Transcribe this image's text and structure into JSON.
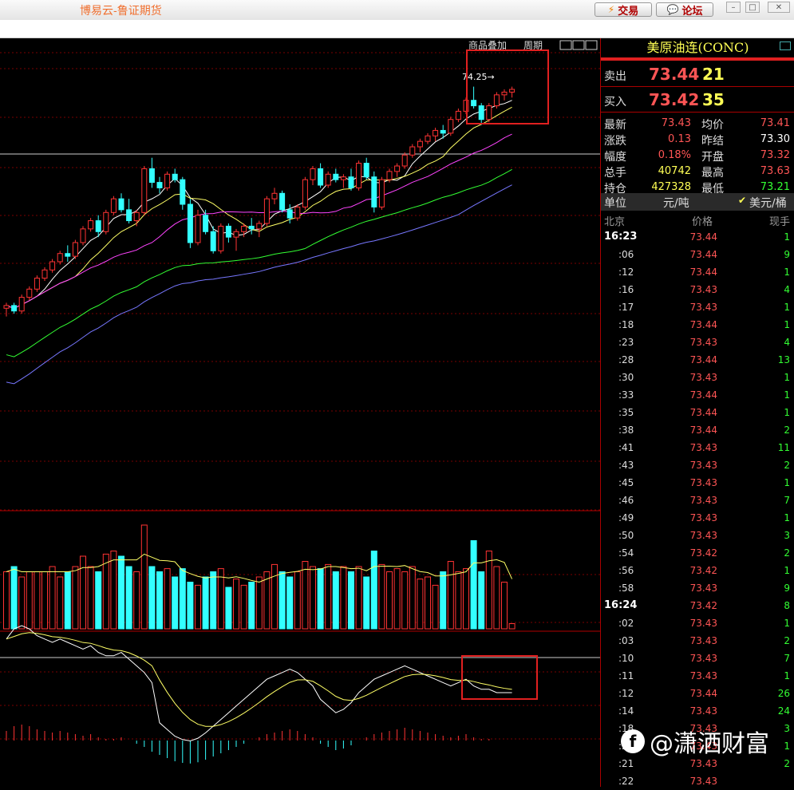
{
  "window": {
    "title": "博易云-鲁证期货",
    "trade_button": "交易",
    "forum_button": "论坛",
    "trade_icon": "lightning-icon",
    "forum_icon": "speech-bubble-icon"
  },
  "chart_toolbar": {
    "overlay_label": "商品叠加",
    "period_label": "周期"
  },
  "chart_annotation": {
    "high_label": "74.25→"
  },
  "colors": {
    "up": "#ff3333",
    "down": "#33ffff",
    "ma5": "#ffffff",
    "ma10": "#ffff66",
    "ma20": "#ff44ff",
    "ma40": "#33ff33",
    "ma60": "#7777ff",
    "highlight": "#e02020"
  },
  "panel": {
    "title": "美原油连(CONC)",
    "sell": {
      "label": "卖出",
      "price": "73.44",
      "vol": "21"
    },
    "buy": {
      "label": "买入",
      "price": "73.42",
      "vol": "35"
    },
    "stats": [
      {
        "l1": "最新",
        "v1": "73.43",
        "c1": "#ff5555",
        "l2": "均价",
        "v2": "73.41",
        "c2": "#ff5555"
      },
      {
        "l1": "涨跌",
        "v1": "0.13",
        "c1": "#ff5555",
        "l2": "昨结",
        "v2": "73.30",
        "c2": "#ffffff"
      },
      {
        "l1": "幅度",
        "v1": "0.18%",
        "c1": "#ff5555",
        "l2": "开盘",
        "v2": "73.32",
        "c2": "#ff5555"
      },
      {
        "l1": "总手",
        "v1": "40742",
        "c1": "#ffff55",
        "l2": "最高",
        "v2": "73.63",
        "c2": "#ff5555"
      },
      {
        "l1": "持仓",
        "v1": "427328",
        "c1": "#ffff55",
        "l2": "最低",
        "v2": "73.21",
        "c2": "#33ff33"
      }
    ],
    "unit_label": "单位",
    "unit_cny": "元/吨",
    "unit_usd": "美元/桶",
    "tick_head": {
      "time": "北京",
      "price": "价格",
      "vol": "现手"
    },
    "ticks": [
      {
        "t": "16:23",
        "p": "73.44",
        "v": "1"
      },
      {
        "t": ":06",
        "p": "73.44",
        "v": "9"
      },
      {
        "t": ":12",
        "p": "73.44",
        "v": "1"
      },
      {
        "t": ":16",
        "p": "73.43",
        "v": "4"
      },
      {
        "t": ":17",
        "p": "73.43",
        "v": "1"
      },
      {
        "t": ":18",
        "p": "73.44",
        "v": "1"
      },
      {
        "t": ":23",
        "p": "73.43",
        "v": "4"
      },
      {
        "t": ":28",
        "p": "73.44",
        "v": "13"
      },
      {
        "t": ":30",
        "p": "73.43",
        "v": "1"
      },
      {
        "t": ":33",
        "p": "73.44",
        "v": "1"
      },
      {
        "t": ":35",
        "p": "73.44",
        "v": "1"
      },
      {
        "t": ":38",
        "p": "73.44",
        "v": "2"
      },
      {
        "t": ":41",
        "p": "73.43",
        "v": "11"
      },
      {
        "t": ":43",
        "p": "73.43",
        "v": "2"
      },
      {
        "t": ":45",
        "p": "73.43",
        "v": "1"
      },
      {
        "t": ":46",
        "p": "73.43",
        "v": "7"
      },
      {
        "t": ":49",
        "p": "73.43",
        "v": "1"
      },
      {
        "t": ":50",
        "p": "73.43",
        "v": "3"
      },
      {
        "t": ":54",
        "p": "73.42",
        "v": "2"
      },
      {
        "t": ":56",
        "p": "73.42",
        "v": "1"
      },
      {
        "t": ":58",
        "p": "73.43",
        "v": "9"
      },
      {
        "t": "16:24",
        "p": "73.42",
        "v": "8"
      },
      {
        "t": ":02",
        "p": "73.43",
        "v": "1"
      },
      {
        "t": ":03",
        "p": "73.43",
        "v": "2"
      },
      {
        "t": ":10",
        "p": "73.43",
        "v": "7"
      },
      {
        "t": ":11",
        "p": "73.43",
        "v": "1"
      },
      {
        "t": ":12",
        "p": "73.44",
        "v": "26"
      },
      {
        "t": ":14",
        "p": "73.43",
        "v": "24"
      },
      {
        "t": ":18",
        "p": "73.43",
        "v": "3"
      },
      {
        "t": ":20",
        "p": "73.43",
        "v": "1"
      },
      {
        "t": ":21",
        "p": "73.43",
        "v": "2"
      },
      {
        "t": ":22",
        "p": "73.43",
        "v": ""
      }
    ]
  },
  "watermark": {
    "text": "@潇洒财富"
  },
  "chart_data": {
    "type": "candlestick",
    "candles": [
      [
        70.2,
        70.3,
        70.05,
        70.25
      ],
      [
        70.25,
        70.3,
        70.1,
        70.15
      ],
      [
        70.15,
        70.45,
        70.1,
        70.4
      ],
      [
        70.4,
        70.6,
        70.35,
        70.55
      ],
      [
        70.55,
        70.8,
        70.5,
        70.75
      ],
      [
        70.75,
        70.95,
        70.7,
        70.9
      ],
      [
        70.9,
        71.1,
        70.85,
        71.05
      ],
      [
        71.05,
        71.25,
        71.0,
        71.2
      ],
      [
        71.2,
        71.35,
        71.05,
        71.15
      ],
      [
        71.15,
        71.45,
        71.1,
        71.4
      ],
      [
        71.4,
        71.7,
        71.35,
        71.65
      ],
      [
        71.65,
        71.85,
        71.6,
        71.8
      ],
      [
        71.8,
        71.9,
        71.5,
        71.6
      ],
      [
        71.6,
        72.0,
        71.55,
        71.95
      ],
      [
        71.95,
        72.25,
        71.9,
        72.2
      ],
      [
        72.2,
        72.3,
        71.95,
        72.0
      ],
      [
        72.0,
        72.2,
        71.75,
        71.8
      ],
      [
        71.8,
        72.0,
        71.7,
        71.95
      ],
      [
        71.95,
        72.8,
        71.9,
        72.75
      ],
      [
        72.75,
        72.95,
        72.4,
        72.5
      ],
      [
        72.5,
        72.6,
        72.3,
        72.4
      ],
      [
        72.4,
        72.7,
        72.35,
        72.65
      ],
      [
        72.65,
        72.75,
        72.5,
        72.55
      ],
      [
        72.55,
        72.6,
        72.0,
        72.1
      ],
      [
        72.1,
        72.2,
        71.3,
        71.4
      ],
      [
        71.4,
        72.0,
        71.35,
        71.9
      ],
      [
        71.9,
        72.0,
        71.55,
        71.6
      ],
      [
        71.6,
        71.7,
        71.2,
        71.25
      ],
      [
        71.25,
        71.75,
        71.2,
        71.7
      ],
      [
        71.7,
        71.75,
        71.4,
        71.5
      ],
      [
        71.5,
        71.65,
        71.25,
        71.6
      ],
      [
        71.6,
        71.75,
        71.5,
        71.7
      ],
      [
        71.7,
        71.85,
        71.55,
        71.65
      ],
      [
        71.65,
        71.8,
        71.5,
        71.75
      ],
      [
        71.75,
        72.25,
        71.7,
        72.2
      ],
      [
        72.2,
        72.4,
        72.1,
        72.3
      ],
      [
        72.3,
        72.35,
        71.95,
        72.0
      ],
      [
        72.0,
        72.1,
        71.75,
        71.85
      ],
      [
        71.85,
        72.1,
        71.8,
        72.05
      ],
      [
        72.05,
        72.6,
        72.0,
        72.55
      ],
      [
        72.55,
        72.8,
        72.45,
        72.75
      ],
      [
        72.75,
        72.85,
        72.4,
        72.45
      ],
      [
        72.45,
        72.7,
        72.4,
        72.65
      ],
      [
        72.65,
        72.75,
        72.5,
        72.55
      ],
      [
        72.55,
        72.65,
        72.4,
        72.6
      ],
      [
        72.6,
        72.75,
        72.35,
        72.4
      ],
      [
        72.4,
        72.9,
        72.35,
        72.85
      ],
      [
        72.85,
        72.95,
        72.55,
        72.6
      ],
      [
        72.6,
        72.7,
        71.95,
        72.05
      ],
      [
        72.05,
        72.6,
        72.0,
        72.55
      ],
      [
        72.55,
        72.75,
        72.5,
        72.7
      ],
      [
        72.7,
        72.85,
        72.6,
        72.8
      ],
      [
        72.8,
        73.05,
        72.75,
        73.0
      ],
      [
        73.0,
        73.2,
        72.95,
        73.15
      ],
      [
        73.15,
        73.3,
        73.05,
        73.25
      ],
      [
        73.25,
        73.4,
        73.2,
        73.35
      ],
      [
        73.35,
        73.5,
        73.25,
        73.45
      ],
      [
        73.45,
        73.55,
        73.3,
        73.4
      ],
      [
        73.4,
        73.7,
        73.35,
        73.65
      ],
      [
        73.65,
        73.85,
        73.6,
        73.8
      ],
      [
        73.8,
        74.05,
        73.75,
        74.0
      ],
      [
        74.0,
        74.25,
        73.85,
        73.9
      ],
      [
        73.9,
        73.95,
        73.55,
        73.65
      ],
      [
        73.65,
        73.95,
        73.6,
        73.9
      ],
      [
        73.9,
        74.15,
        73.85,
        74.1
      ],
      [
        74.1,
        74.2,
        74.0,
        74.15
      ],
      [
        74.15,
        74.25,
        74.05,
        74.2
      ]
    ],
    "volume": [
      0.55,
      0.6,
      0.5,
      0.55,
      0.55,
      0.55,
      0.6,
      0.5,
      0.55,
      0.6,
      0.7,
      0.6,
      0.55,
      0.72,
      0.75,
      0.7,
      0.6,
      0.55,
      1.0,
      0.6,
      0.55,
      0.58,
      0.5,
      0.58,
      0.45,
      0.42,
      0.5,
      0.55,
      0.58,
      0.4,
      0.48,
      0.42,
      0.45,
      0.5,
      0.55,
      0.62,
      0.55,
      0.5,
      0.55,
      0.65,
      0.6,
      0.58,
      0.62,
      0.55,
      0.6,
      0.55,
      0.6,
      0.5,
      0.75,
      0.62,
      0.55,
      0.58,
      0.55,
      0.6,
      0.48,
      0.5,
      0.42,
      0.55,
      0.65,
      0.55,
      0.58,
      0.85,
      0.55,
      0.75,
      0.6,
      0.45,
      0.05
    ],
    "macd": [
      0.3,
      0.45,
      0.5,
      0.45,
      0.35,
      0.3,
      0.25,
      0.3,
      0.25,
      0.2,
      0.15,
      0.2,
      0.1,
      0.05,
      0.05,
      0.1,
      0.0,
      -0.1,
      -0.2,
      -0.35,
      -0.45,
      -0.55,
      -0.65,
      -0.7,
      -0.72,
      -0.68,
      -0.6,
      -0.5,
      -0.4,
      -0.3,
      -0.2,
      -0.1,
      0.0,
      0.1,
      0.2,
      0.25,
      0.3,
      0.35,
      0.3,
      0.2,
      0.1,
      -0.1,
      -0.2,
      -0.3,
      -0.25,
      -0.15,
      0.0,
      0.1,
      0.2,
      0.25,
      0.3,
      0.35,
      0.4,
      0.35,
      0.3,
      0.25,
      0.2,
      0.15,
      0.1,
      0.15,
      0.2,
      0.1,
      0.05,
      0.05,
      0.0,
      0.0,
      0.0
    ]
  }
}
